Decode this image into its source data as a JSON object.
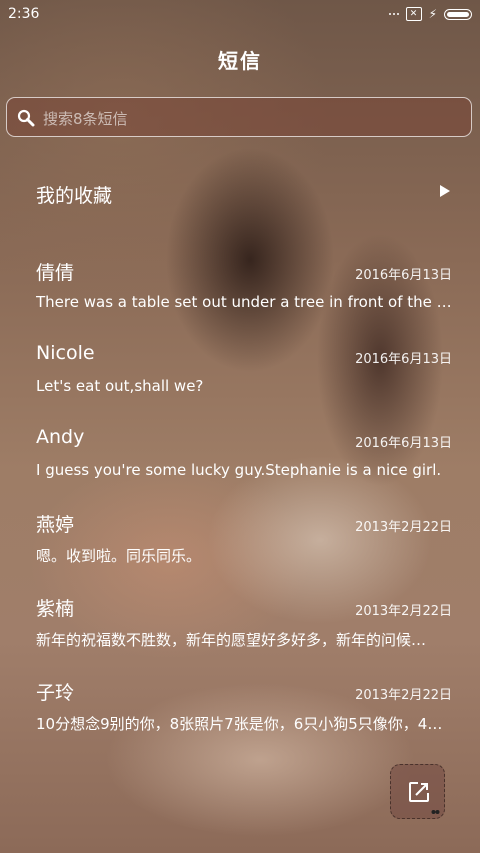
{
  "status_bar": {
    "time": "2:36"
  },
  "header": {
    "title": "短信"
  },
  "search": {
    "placeholder": "搜索8条短信"
  },
  "favorites": {
    "label": "我的收藏"
  },
  "conversations": [
    {
      "name": "倩倩",
      "date": "2016年6月13日",
      "preview": "There was a table set out under a tree in front of the house..."
    },
    {
      "name": "Nicole",
      "date": "2016年6月13日",
      "preview": "Let's eat out,shall we?"
    },
    {
      "name": "Andy",
      "date": "2016年6月13日",
      "preview": "I guess you're some lucky guy.Stephanie is a nice girl."
    },
    {
      "name": "燕婷",
      "date": "2013年2月22日",
      "preview": "嗯。收到啦。同乐同乐。"
    },
    {
      "name": "紫楠",
      "date": "2013年2月22日",
      "preview": "新年的祝福数不胜数，新年的愿望好多好多，新年的问候…"
    },
    {
      "name": "子玲",
      "date": "2013年2月22日",
      "preview": "10分想念9别的你，8张照片7张是你，6只小狗5只像你，4…"
    }
  ],
  "icons": {
    "search": "search-icon",
    "favorites_arrow": "play-arrow-icon",
    "compose": "compose-icon"
  }
}
